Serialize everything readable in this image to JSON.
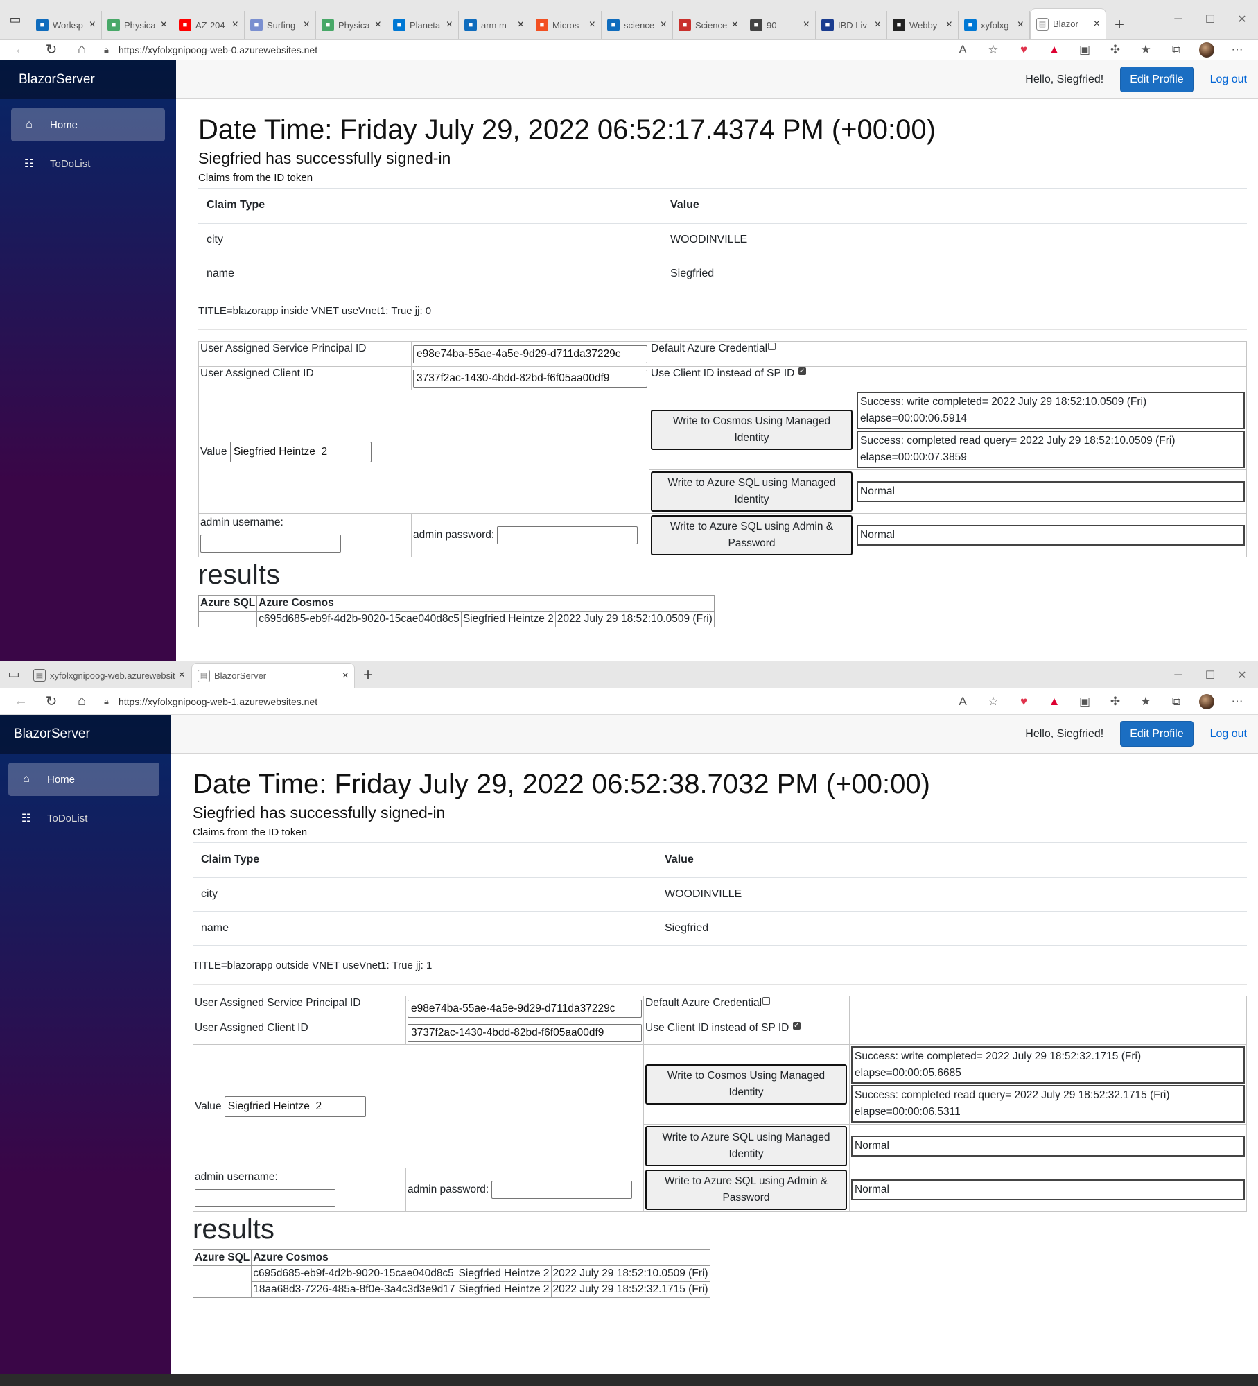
{
  "window1": {
    "tabs": [
      {
        "label": "Worksp",
        "icon": "mail-icon",
        "color": "#0f6cbd"
      },
      {
        "label": "Physica",
        "icon": "page-icon",
        "color": "#48a868"
      },
      {
        "label": "AZ-204",
        "icon": "youtube-icon",
        "color": "#ff0000"
      },
      {
        "label": "Surfing",
        "icon": "site-icon",
        "color": "#7a8fd0"
      },
      {
        "label": "Physica",
        "icon": "page-icon",
        "color": "#48a868"
      },
      {
        "label": "Planeta",
        "icon": "azure-icon",
        "color": "#0078d4"
      },
      {
        "label": "arm m",
        "icon": "search-icon",
        "color": "#0f6cbd"
      },
      {
        "label": "Micros",
        "icon": "microsoft-icon",
        "color": "#f25022"
      },
      {
        "label": "science",
        "icon": "search-icon",
        "color": "#0f6cbd"
      },
      {
        "label": "Science",
        "icon": "science-icon",
        "color": "#c9302c"
      },
      {
        "label": "90",
        "icon": "audio-icon",
        "color": "#444444"
      },
      {
        "label": "IBD Liv",
        "icon": "ibd-icon",
        "color": "#1a3c8f"
      },
      {
        "label": "Webby",
        "icon": "chart-icon",
        "color": "#222222"
      },
      {
        "label": "xyfolxg",
        "icon": "azure-icon",
        "color": "#0078d4"
      }
    ],
    "active_tab": "Blazor",
    "url": "https://xyfolxgnipoog-web-0.azurewebsites.net",
    "datetime": "Date Time: Friday July 29, 2022 06:52:17.4374 PM (+00:00)",
    "title_line": "TITLE=blazorapp inside VNET useVnet1: True jj: 0",
    "cosmos_write_result": [
      "Success: write completed= 2022 July 29 18:52:10.0509 (Fri)",
      "elapse=00:00:06.5914"
    ],
    "cosmos_read_result": [
      "Success: completed read query= 2022 July 29 18:52:10.0509 (Fri)",
      "elapse=00:00:07.3859"
    ],
    "results_rows": [
      [
        "c695d685-eb9f-4d2b-9020-15cae040d8c5",
        "Siegfried Heintze 2",
        "2022 July 29 18:52:10.0509 (Fri)"
      ]
    ]
  },
  "window2": {
    "tabs": [
      {
        "label": "xyfolxgnipoog-web.azurewebsite",
        "icon": "page-icon",
        "color": "#444444"
      }
    ],
    "active_tab": "BlazorServer",
    "url": "https://xyfolxgnipoog-web-1.azurewebsites.net",
    "datetime": "Date Time: Friday July 29, 2022 06:52:38.7032 PM (+00:00)",
    "title_line": "TITLE=blazorapp outside VNET useVnet1: True jj: 1",
    "cosmos_write_result": [
      "Success: write completed= 2022 July 29 18:52:32.1715 (Fri)",
      "elapse=00:00:05.6685"
    ],
    "cosmos_read_result": [
      "Success: completed read query= 2022 July 29 18:52:32.1715 (Fri)",
      "elapse=00:00:06.5311"
    ],
    "results_rows": [
      [
        "c695d685-eb9f-4d2b-9020-15cae040d8c5",
        "Siegfried Heintze 2",
        "2022 July 29 18:52:10.0509 (Fri)"
      ],
      [
        "18aa68d3-7226-485a-8f0e-3a4c3d3e9d17",
        "Siegfried Heintze 2",
        "2022 July 29 18:52:32.1715 (Fri)"
      ]
    ]
  },
  "app": {
    "brand": "BlazorServer",
    "nav": [
      {
        "label": "Home",
        "icon": "home-icon"
      },
      {
        "label": "ToDoList",
        "icon": "list-icon"
      }
    ],
    "hello": "Hello, Siegfried!",
    "edit_profile": "Edit Profile",
    "logout": "Log out",
    "signin": "Siegfried has successfully signed-in",
    "claims_caption": "Claims from the ID token",
    "claims_headers": [
      "Claim Type",
      "Value"
    ],
    "claims": [
      [
        "city",
        "WOODINVILLE"
      ],
      [
        "name",
        "Siegfried"
      ]
    ],
    "form": {
      "sp_label": "User Assigned Service Principal ID",
      "sp_value": "e98e74ba-55ae-4a5e-9d29-d711da37229c",
      "default_cred_label": "Default Azure Credential",
      "client_label": "User Assigned Client ID",
      "client_value": "3737f2ac-1430-4bdd-82bd-f6f05aa00df9",
      "use_client_label": "Use Client ID instead of SP ID",
      "value_label": "Value",
      "value_value": "Siegfried Heintze  2",
      "cosmos_button": "Write to Cosmos Using Managed Identity",
      "sql_mi_button": "Write to Azure SQL using Managed Identity",
      "sql_admin_button": "Write to Azure SQL using Admin & Password",
      "admin_user_label": "admin username:",
      "admin_pw_label": "admin password:",
      "normal": "Normal"
    },
    "results_title": "results",
    "results_headers": [
      "Azure SQL",
      "Azure Cosmos"
    ]
  },
  "colors": {
    "sidebar_top": "#052767",
    "sidebar_bottom": "#3a0647",
    "primary": "#1b6ec2",
    "link": "#0366d6"
  }
}
